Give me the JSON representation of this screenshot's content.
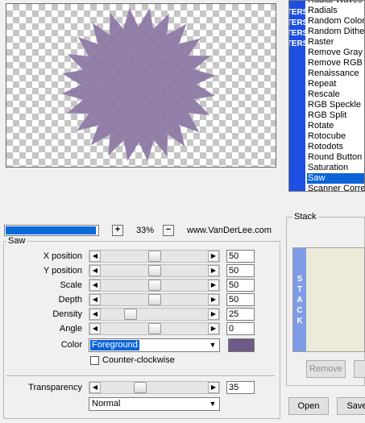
{
  "filters": {
    "side_tab": "TERS",
    "items": [
      "Radial Waves",
      "Radials",
      "Random Colors",
      "Random Dither",
      "Raster",
      "Remove Gray",
      "Remove RGB",
      "Renaissance",
      "Repeat",
      "Rescale",
      "RGB Speckle",
      "RGB Split",
      "Rotate",
      "Rotocube",
      "Rotodots",
      "Round Button",
      "Saturation",
      "Saw",
      "Scanner Corre"
    ],
    "selected": "Saw"
  },
  "zoom": {
    "plus": "+",
    "minus": "−",
    "value": "33%",
    "progress_fraction": 0.98
  },
  "website": "www.VanDerLee.com",
  "group_title": "Saw",
  "params": [
    {
      "label": "X position",
      "value": "50",
      "fraction": 0.5
    },
    {
      "label": "Y position",
      "value": "50",
      "fraction": 0.5
    },
    {
      "label": "Scale",
      "value": "50",
      "fraction": 0.5
    },
    {
      "label": "Depth",
      "value": "50",
      "fraction": 0.5
    },
    {
      "label": "Density",
      "value": "25",
      "fraction": 0.25
    },
    {
      "label": "Angle",
      "value": "0",
      "fraction": 0.5
    }
  ],
  "color": {
    "label": "Color",
    "value": "Foreground",
    "swatch": "#6e5a86"
  },
  "counter_clockwise": {
    "label": "Counter-clockwise",
    "checked": false
  },
  "transparency": {
    "label": "Transparency",
    "value": "35",
    "fraction": 0.35
  },
  "blend_mode": "Normal",
  "stack": {
    "title": "Stack",
    "side_tab": "STACK",
    "remove_label": "Remove"
  },
  "buttons": {
    "open": "Open",
    "save": "Save"
  },
  "preview_shape_color": "#8e7aa5"
}
